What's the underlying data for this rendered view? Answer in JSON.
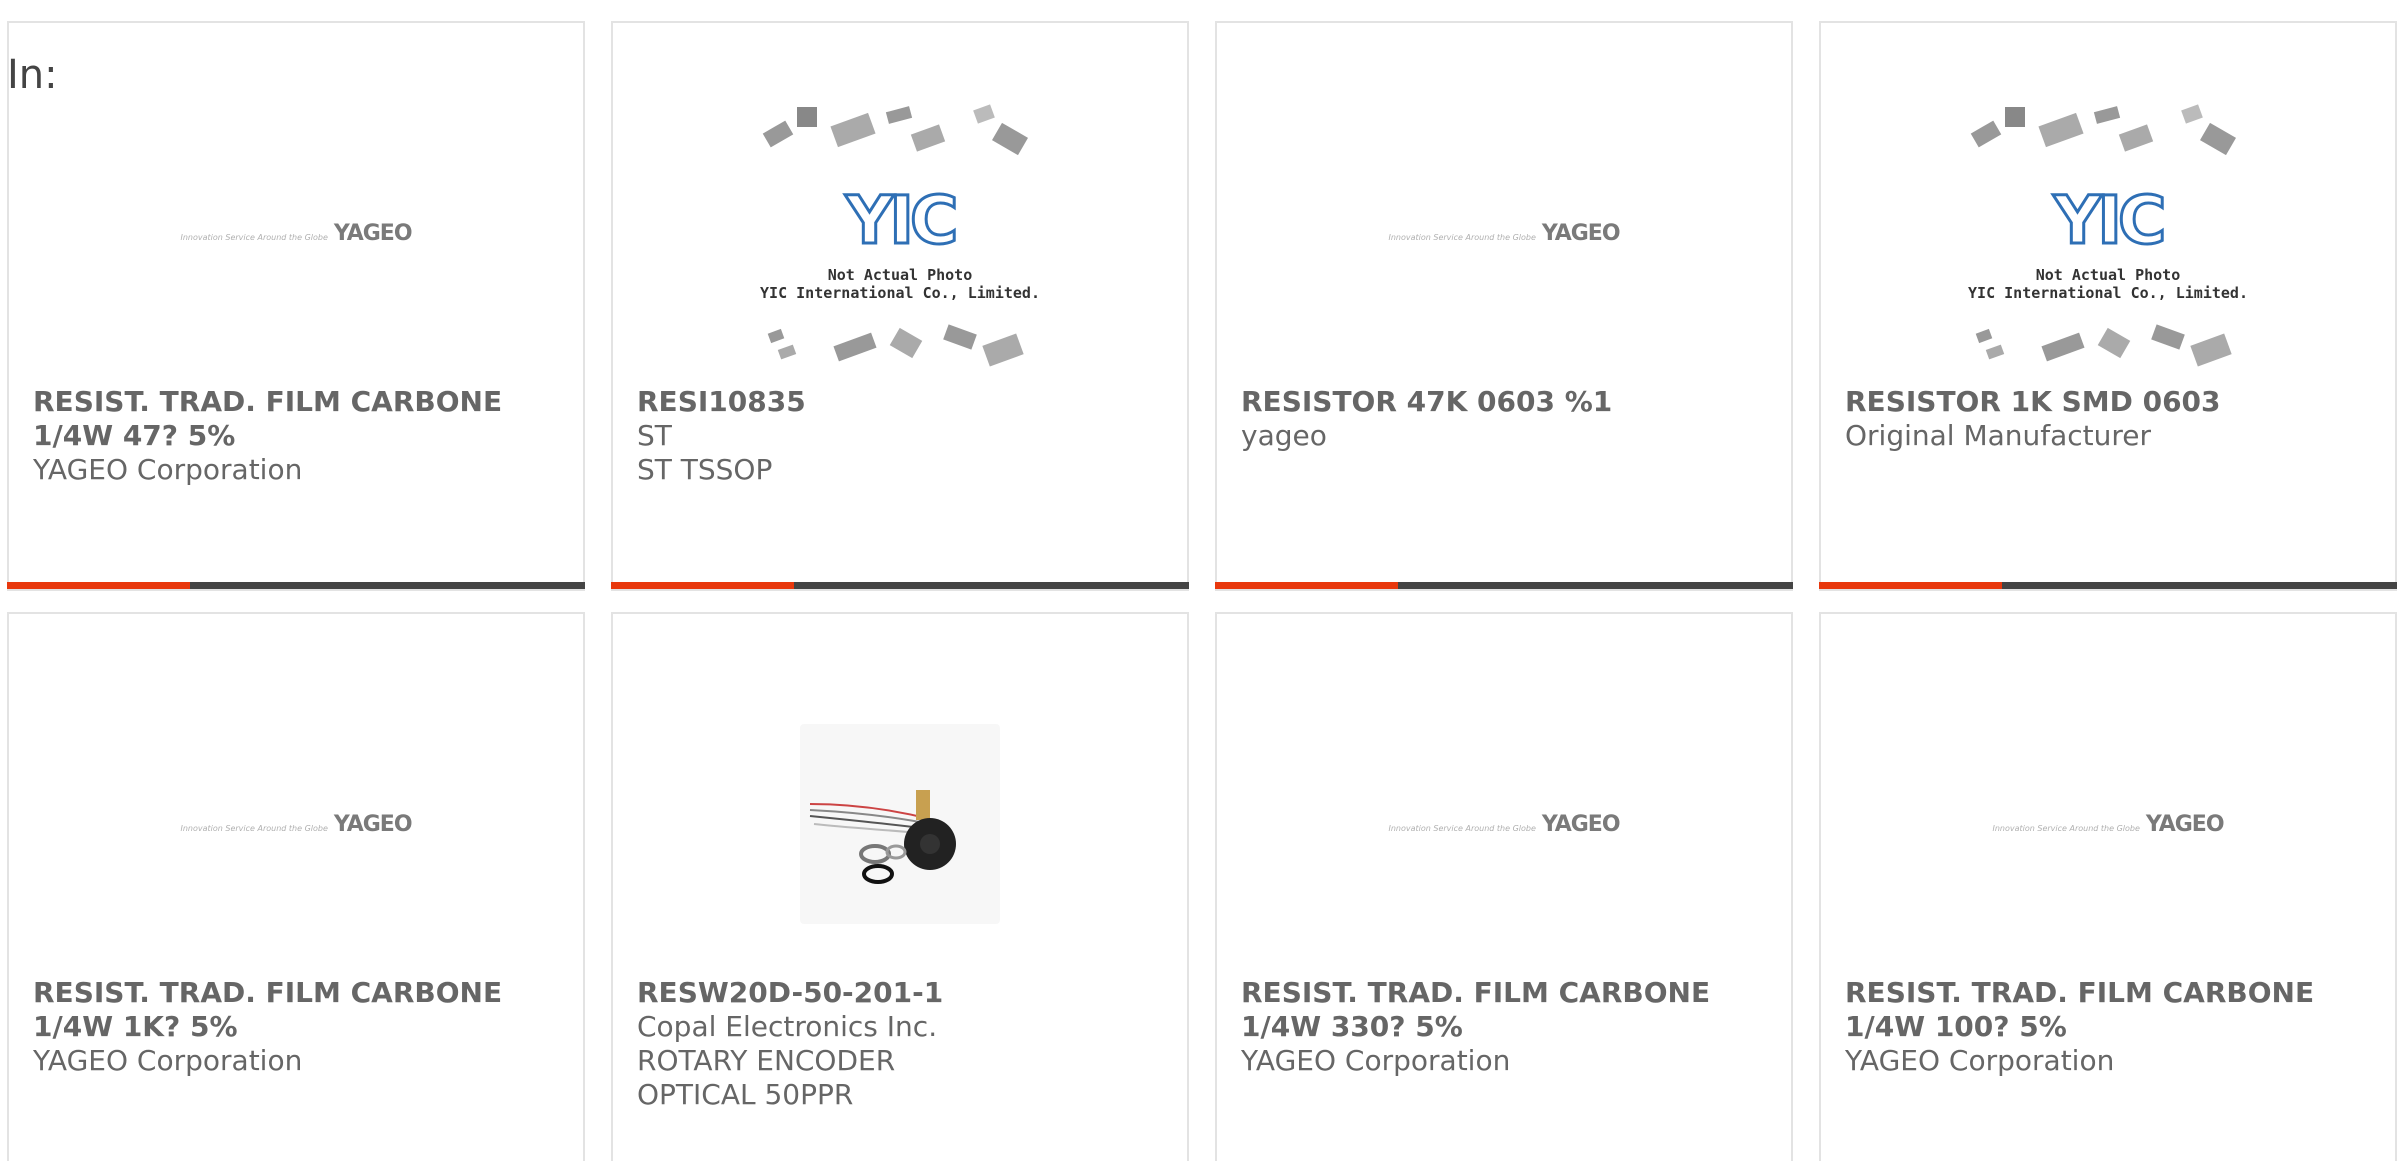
{
  "header": {
    "in_label": "In:"
  },
  "colors": {
    "accent": "#e8380d",
    "bar": "#444444",
    "text": "#666666",
    "border": "#e3e3e3",
    "yic_blue": "#2e6fb5"
  },
  "products": [
    {
      "title": "RESIST. TRAD. FILM CARBONE 1/4W 47? 5%",
      "line1": "YAGEO Corporation",
      "line2": "",
      "image": "yageo-logo"
    },
    {
      "title": "RESI10835",
      "line1": "ST",
      "line2": "ST TSSOP",
      "image": "yic-placeholder"
    },
    {
      "title": "RESISTOR 47K 0603 %1",
      "line1": "yageo",
      "line2": "",
      "image": "yageo-logo"
    },
    {
      "title": "RESISTOR 1K SMD 0603",
      "line1": "Original Manufacturer",
      "line2": "",
      "image": "yic-placeholder"
    },
    {
      "title": "RESIST. TRAD. FILM CARBONE 1/4W 1K? 5%",
      "line1": "YAGEO Corporation",
      "line2": "",
      "image": "yageo-logo"
    },
    {
      "title": "RESW20D-50-201-1",
      "line1": "Copal Electronics Inc.",
      "line2": "ROTARY ENCODER OPTICAL 50PPR",
      "image": "encoder-photo"
    },
    {
      "title": "RESIST. TRAD. FILM CARBONE 1/4W 330? 5%",
      "line1": "YAGEO Corporation",
      "line2": "",
      "image": "yageo-logo"
    },
    {
      "title": "RESIST. TRAD. FILM CARBONE 1/4W 100? 5%",
      "line1": "YAGEO Corporation",
      "line2": "",
      "image": "yageo-logo"
    }
  ],
  "logos": {
    "yageo_brand": "YAGEO",
    "yageo_tagline": "Innovation Service Around the Globe",
    "yic_letters": "YIC",
    "yic_caption_1": "Not Actual Photo",
    "yic_caption_2": "YIC International Co., Limited."
  }
}
